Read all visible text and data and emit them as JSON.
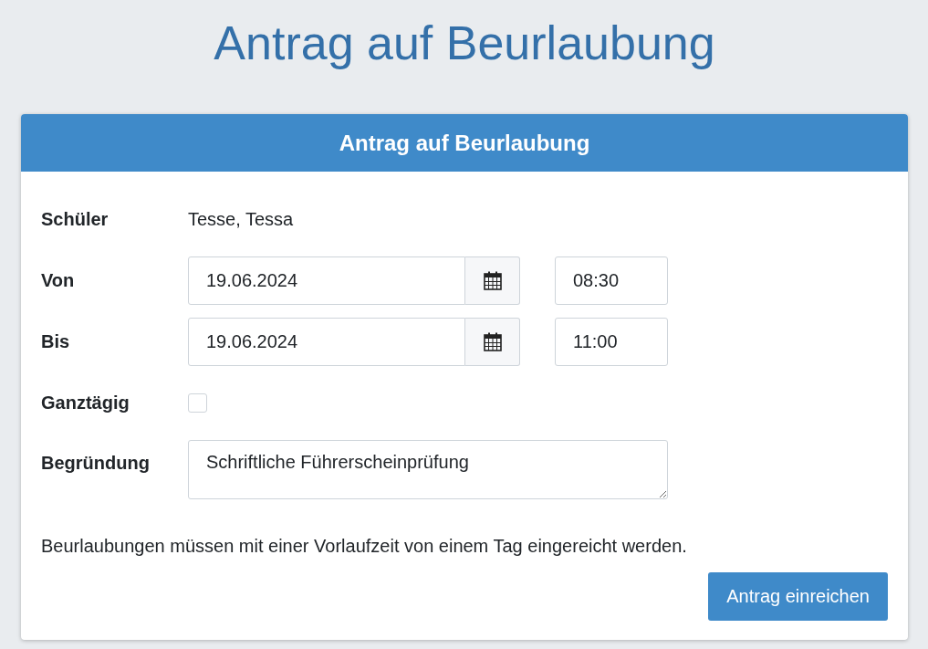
{
  "title": "Antrag auf Beurlaubung",
  "card": {
    "header": "Antrag auf Beurlaubung",
    "fields": [
      {
        "kind": "text",
        "label": "Schüler",
        "value": "Tesse, Tessa"
      },
      {
        "kind": "datetime",
        "label": "Von",
        "date": "19.06.2024",
        "time": "08:30"
      },
      {
        "kind": "datetime",
        "label": "Bis",
        "date": "19.06.2024",
        "time": "11:00"
      },
      {
        "kind": "checkbox",
        "label": "Ganztägig",
        "checked": false
      },
      {
        "kind": "textarea",
        "label": "Begründung",
        "value": "Schriftliche Führerscheinprüfung"
      }
    ],
    "note": "Beurlaubungen müssen mit einer Vorlaufzeit von einem Tag eingereicht werden.",
    "submit": "Antrag einreichen"
  }
}
